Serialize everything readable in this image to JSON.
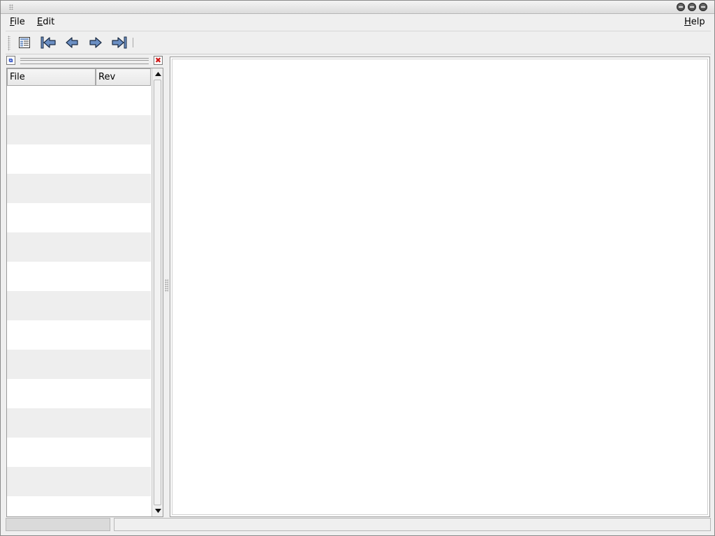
{
  "window": {
    "controls": [
      "minimize-icon",
      "maximize-icon",
      "close-icon"
    ]
  },
  "menubar": {
    "file": {
      "mnemonic": "F",
      "rest": "ile"
    },
    "edit": {
      "mnemonic": "E",
      "rest": "dit"
    },
    "help": {
      "mnemonic": "H",
      "rest": "elp"
    }
  },
  "toolbar": {
    "buttons": [
      "log-view-icon",
      "first-icon",
      "previous-icon",
      "next-icon",
      "last-icon"
    ]
  },
  "file_panel": {
    "columns": [
      "File",
      "Rev"
    ],
    "rows": []
  },
  "status": {
    "left": "",
    "right": ""
  },
  "colors": {
    "window_bg": "#efefef",
    "list_alt_row": "#eeeeee",
    "close_red": "#d01818",
    "icon_blue": "#6b8fc4"
  }
}
